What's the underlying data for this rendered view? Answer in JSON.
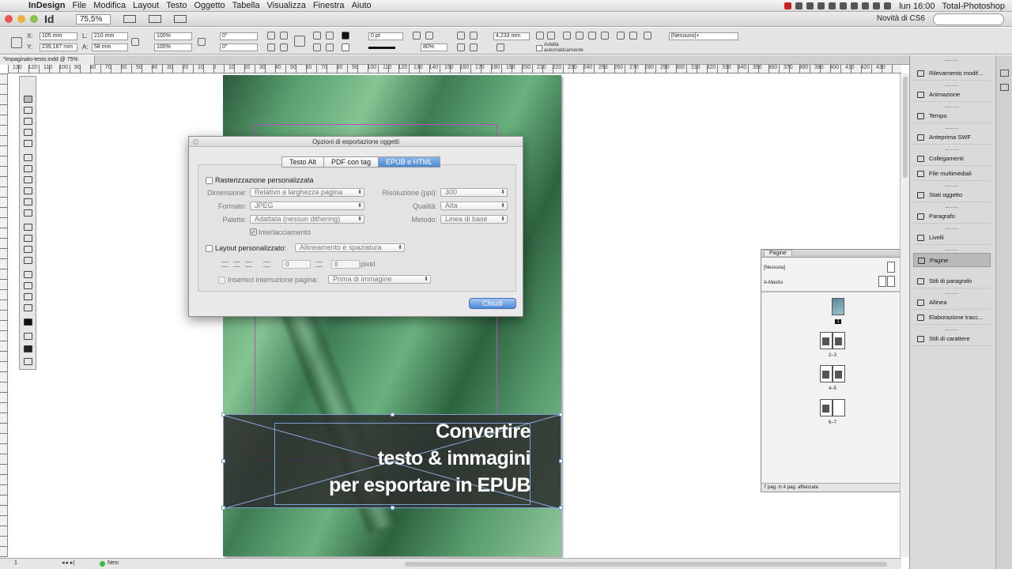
{
  "menubar": {
    "apple": "",
    "app_name": "InDesign",
    "items": [
      "File",
      "Modifica",
      "Layout",
      "Testo",
      "Oggetto",
      "Tabella",
      "Visualizza",
      "Finestra",
      "Aiuto"
    ],
    "clock": "lun 16:00",
    "user": "Total-Photoshop"
  },
  "appbar": {
    "logo": "Id",
    "zoom": "75,5%",
    "workspace": "Novità di CS6"
  },
  "control": {
    "x": "105 mm",
    "y": "239,167 mm",
    "w": "210 mm",
    "h": "58 mm",
    "scale_x": "100%",
    "scale_y": "100%",
    "rotate": "0°",
    "shear": "0°",
    "stroke_weight": "0 pt",
    "opacity": "80%",
    "offset": "4,233 mm",
    "auto_fit": "Adatta automaticamente",
    "style": "[Nessuno]+"
  },
  "document_tab": "*impaginato-testo.indd @ 75%",
  "ruler_labels": [
    "130",
    "120",
    "110",
    "100",
    "90",
    "80",
    "70",
    "60",
    "50",
    "40",
    "30",
    "20",
    "10",
    "0",
    "10",
    "20",
    "30",
    "40",
    "50",
    "60",
    "70",
    "80",
    "90",
    "100",
    "110",
    "120",
    "130",
    "140",
    "150",
    "160",
    "170",
    "180",
    "190",
    "200",
    "210",
    "220",
    "230",
    "240",
    "250",
    "260",
    "270",
    "280",
    "290",
    "300",
    "310",
    "320",
    "330",
    "340",
    "350",
    "360",
    "370",
    "380",
    "390",
    "400",
    "410",
    "420",
    "430"
  ],
  "page_text": {
    "line1": "Convertire",
    "line2": "testo & immagini",
    "line3": "per esportare in EPUB"
  },
  "dialog": {
    "title": "Opzioni di esportazione oggetti",
    "tabs": [
      {
        "label": "Testo Alt",
        "active": false
      },
      {
        "label": "PDF con tag",
        "active": false
      },
      {
        "label": "EPUB e HTML",
        "active": true
      }
    ],
    "rasterize_label": "Rasterizzazione personalizzata",
    "dimension_label": "Dimensione:",
    "dimension_value": "Relativo a larghezza pagina",
    "resolution_label": "Risoluzione (ppi):",
    "resolution_value": "300",
    "format_label": "Formato:",
    "format_value": "JPEG",
    "quality_label": "Qualità:",
    "quality_value": "Alta",
    "palette_label": "Palette:",
    "palette_value": "Adattata (nessun dithering)",
    "method_label": "Metodo:",
    "method_value": "Linea di base",
    "interlace_label": "Interlacciamento",
    "layout_label": "Layout personalizzato:",
    "layout_value": "Allineamento e spaziatura",
    "spacing_before": "0",
    "spacing_after": "0",
    "unit": "pixel",
    "page_break_label": "Inserisci interruzione pagina:",
    "page_break_value": "Prima di immagine",
    "close_button": "Chiudi"
  },
  "pages_panel": {
    "title": "Pagine",
    "none_master": "[Nessuna]",
    "master": "A-Mastro",
    "page_labels": [
      "1",
      "2–3",
      "4–5",
      "6–7"
    ],
    "footer": "7 pag. in 4 pag. affiancate"
  },
  "statusbar": {
    "page": "1",
    "status": "Nessun errore"
  },
  "right_panels": [
    "Rilevamento modif...",
    "Animazione",
    "Tempo",
    "Anteprima SWF",
    "Collegamenti",
    "File multimediali",
    "Stati oggetto",
    "Paragrafo",
    "Livelli",
    "Pagine",
    "Stili di paragrafo",
    "Allinea",
    "Elaborazione tracc...",
    "Stili di carattere"
  ]
}
